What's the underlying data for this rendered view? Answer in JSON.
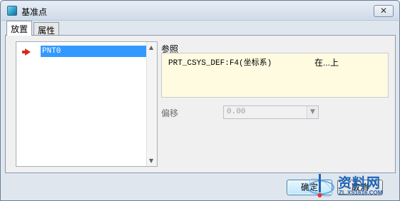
{
  "window": {
    "title": "基准点",
    "close_glyph": "✕"
  },
  "tabs": [
    {
      "label": "放置",
      "active": true
    },
    {
      "label": "属性",
      "active": false
    }
  ],
  "points_list": {
    "items": [
      {
        "label": "PNT0",
        "selected": true,
        "marker_icon": "red-arrow-pointer-icon"
      }
    ],
    "scroll_up_glyph": "▲",
    "scroll_down_glyph": "▼"
  },
  "references": {
    "label": "参照",
    "items": [
      {
        "name": "PRT_CSYS_DEF:F4(坐标系)",
        "constraint": "在...上"
      }
    ]
  },
  "offset": {
    "label": "偏移",
    "value": "0.00",
    "enabled": false,
    "dropdown_glyph": "▼"
  },
  "buttons": {
    "ok": "确定",
    "cancel": "取消"
  },
  "watermark": {
    "title": "资料网",
    "url": "ZL.XS1616.COM"
  },
  "colors": {
    "selection": "#3399ff",
    "reference_box": "#fffbe1",
    "marker": "#d42a1f",
    "watermark": "#1d63b7"
  }
}
